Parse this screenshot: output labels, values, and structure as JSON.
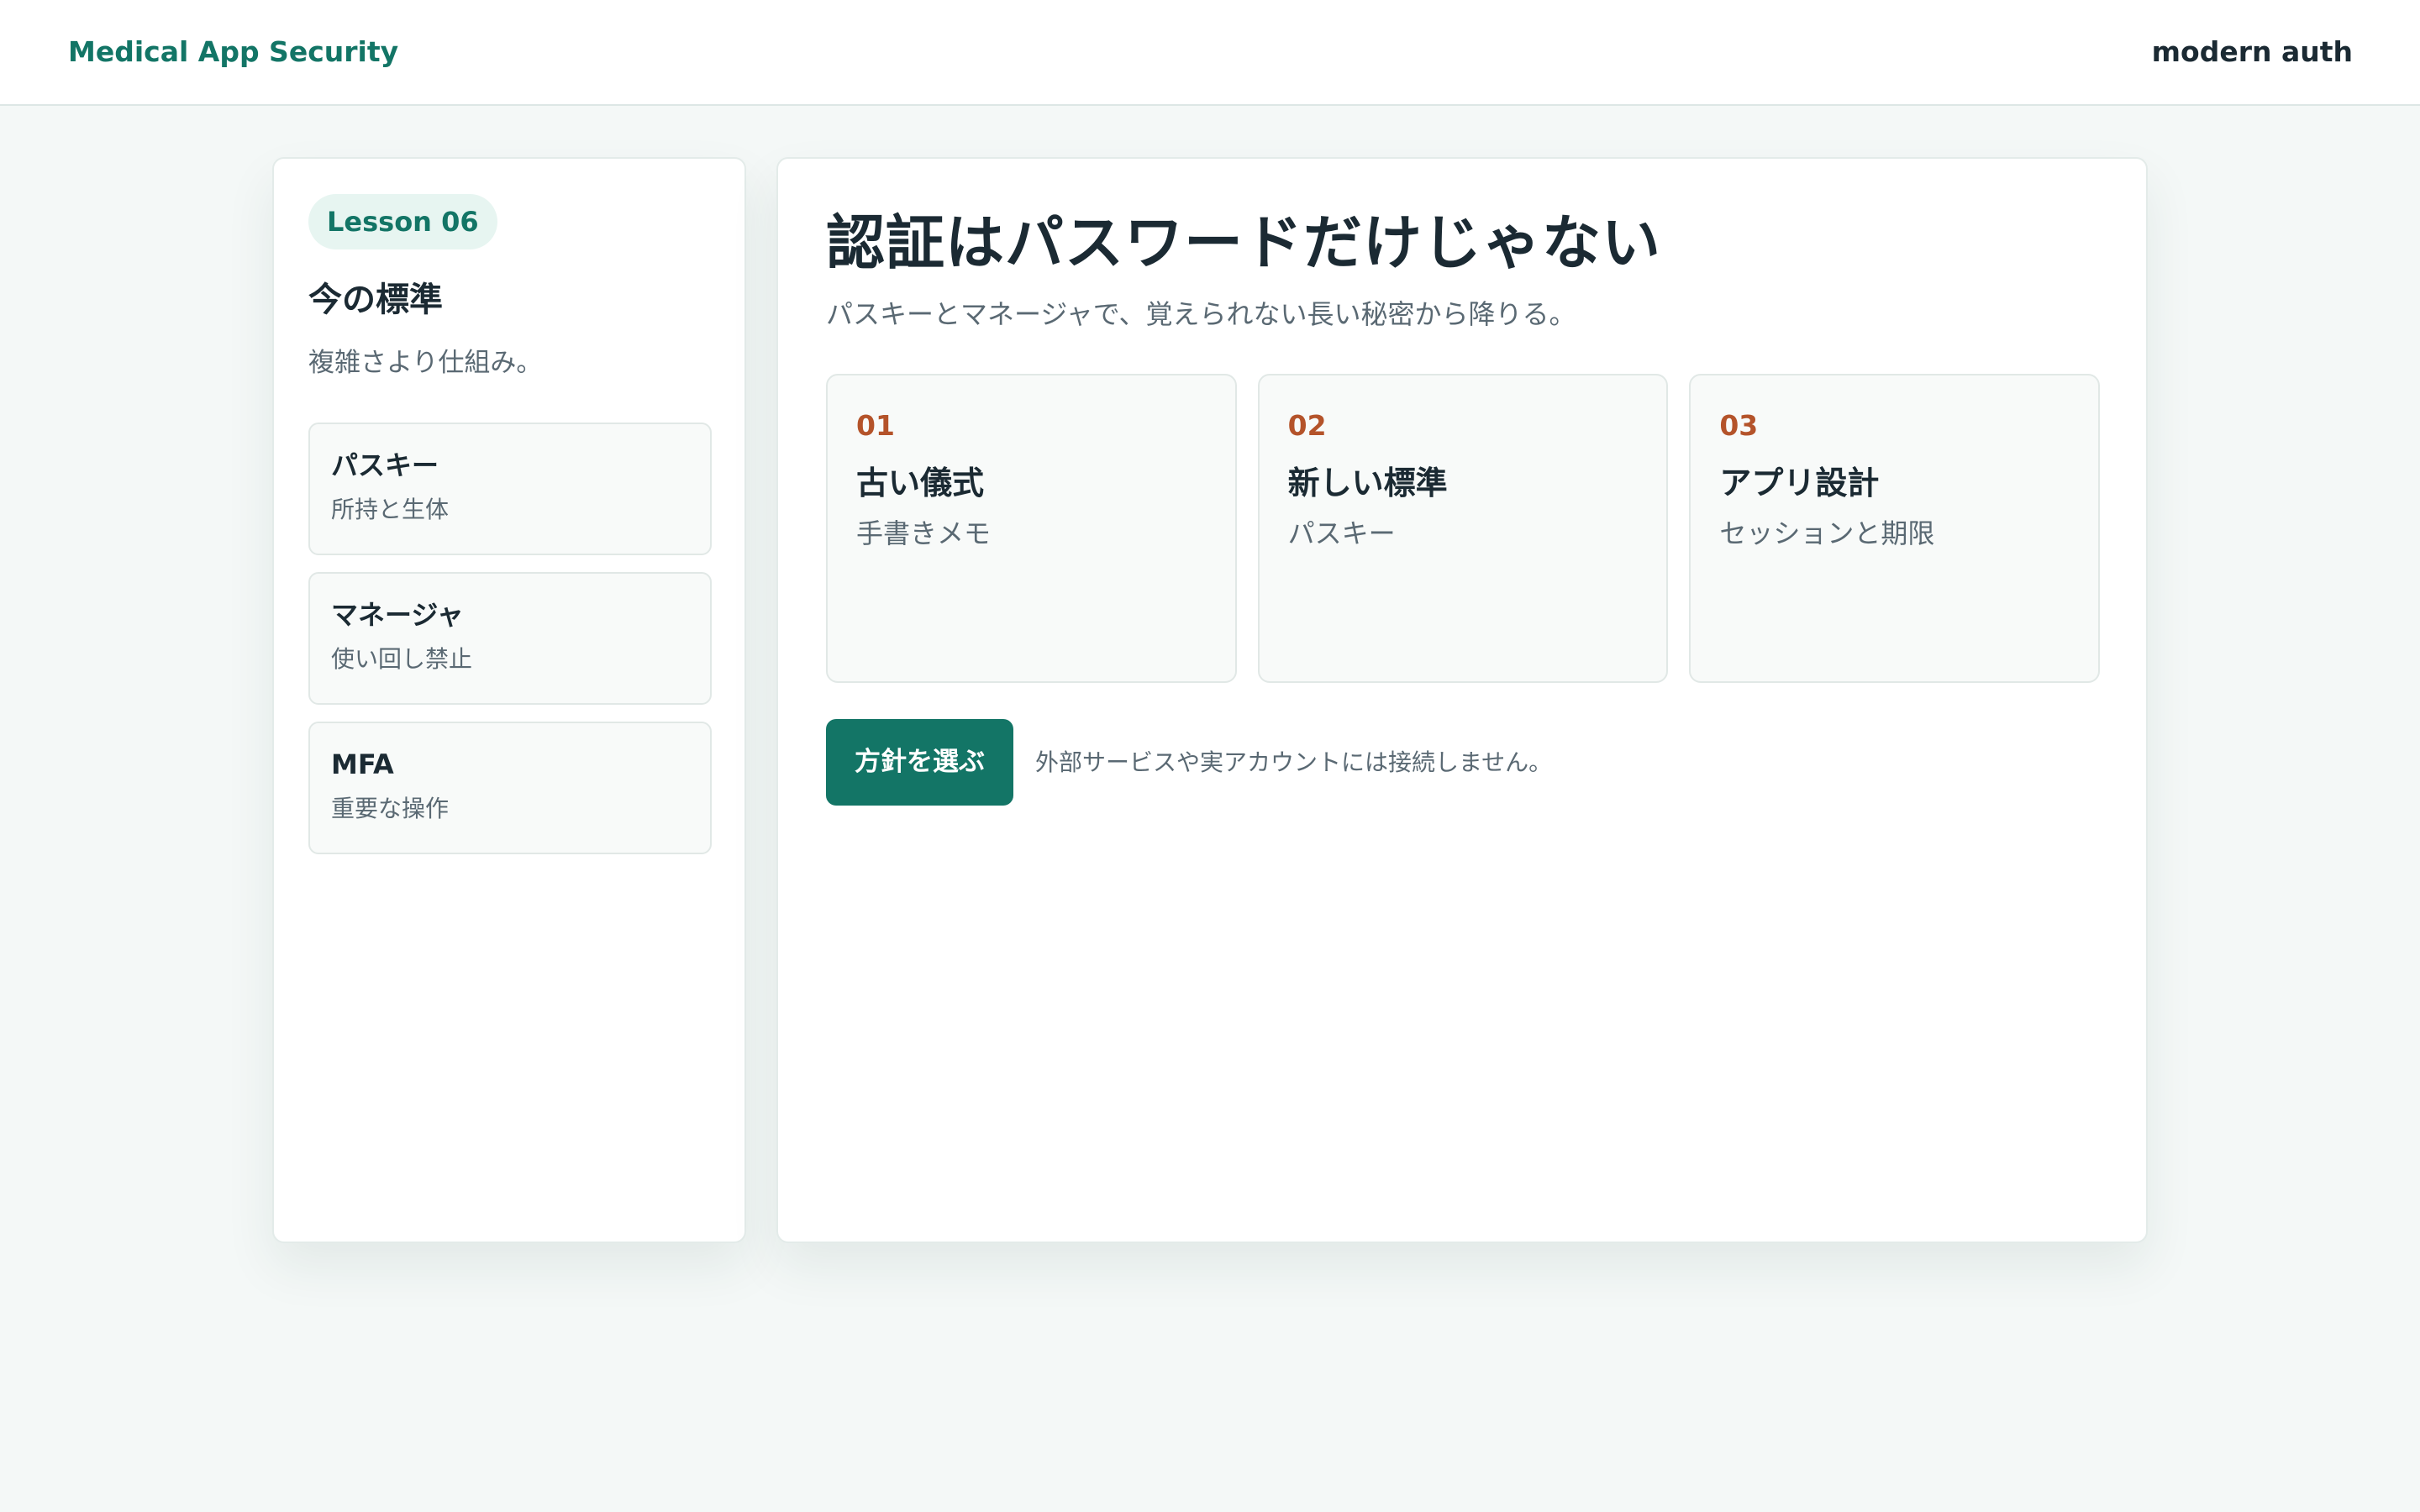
{
  "header": {
    "brand": "Medical App Security",
    "right_label": "modern auth"
  },
  "sidebar": {
    "badge": "Lesson 06",
    "heading": "今の標準",
    "subheading": "複雑さより仕組み。",
    "items": [
      {
        "title": "パスキー",
        "desc": "所持と生体"
      },
      {
        "title": "マネージャ",
        "desc": "使い回し禁止"
      },
      {
        "title": "MFA",
        "desc": "重要な操作"
      }
    ]
  },
  "main": {
    "title": "認証はパスワードだけじゃない",
    "subtitle": "パスキーとマネージャで、覚えられない長い秘密から降りる。",
    "steps": [
      {
        "num": "01",
        "title": "古い儀式",
        "desc": "手書きメモ"
      },
      {
        "num": "02",
        "title": "新しい標準",
        "desc": "パスキー"
      },
      {
        "num": "03",
        "title": "アプリ設計",
        "desc": "セッションと期限"
      }
    ],
    "button_label": "方針を選ぶ",
    "note": "外部サービスや実アカウントには接続しません。"
  },
  "colors": {
    "accent": "#137566",
    "step_number": "#b4532a",
    "background": "#f4f8f7"
  }
}
